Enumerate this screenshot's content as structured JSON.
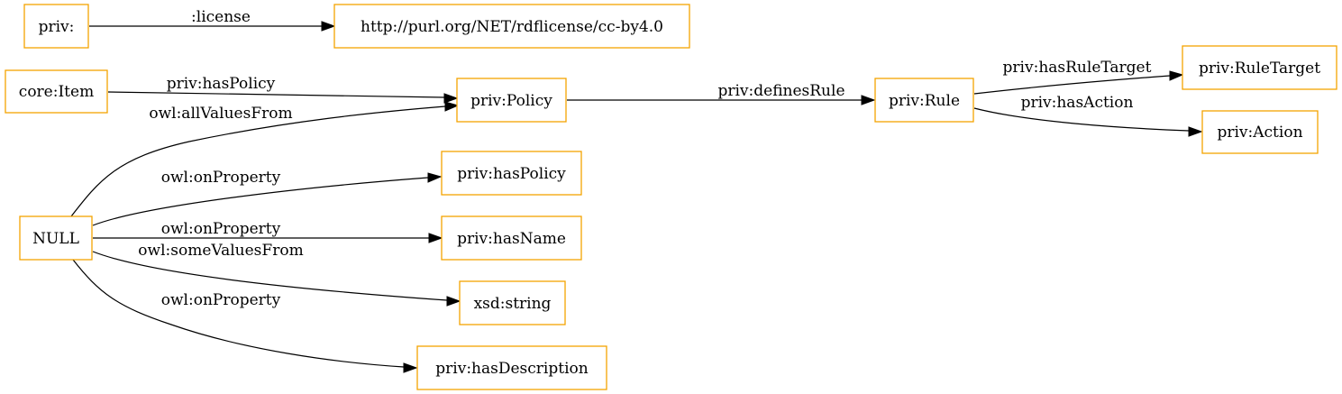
{
  "nodes": {
    "priv": "priv:",
    "license_url": "http://purl.org/NET/rdflicense/cc-by4.0",
    "core_item": "core:Item",
    "priv_policy": "priv:Policy",
    "priv_rule": "priv:Rule",
    "priv_rule_target": "priv:RuleTarget",
    "priv_action": "priv:Action",
    "null": "NULL",
    "priv_has_policy": "priv:hasPolicy",
    "priv_has_name": "priv:hasName",
    "xsd_string": "xsd:string",
    "priv_has_description": "priv:hasDescription"
  },
  "edges": {
    "license": ":license",
    "has_policy": "priv:hasPolicy",
    "defines_rule": "priv:definesRule",
    "has_rule_target": "priv:hasRuleTarget",
    "has_action": "priv:hasAction",
    "all_values_from": "owl:allValuesFrom",
    "on_property_1": "owl:onProperty",
    "on_property_2": "owl:onProperty",
    "some_values_from": "owl:someValuesFrom",
    "on_property_3": "owl:onProperty"
  },
  "colors": {
    "node_border": "#f5a300",
    "edge": "#000000"
  }
}
